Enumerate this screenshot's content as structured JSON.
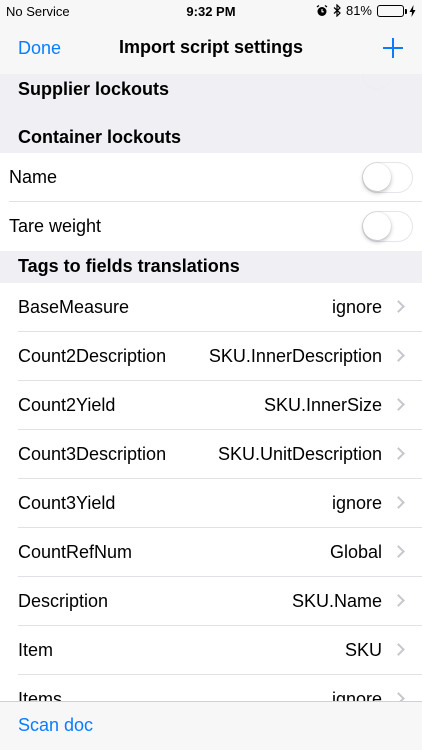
{
  "status_bar": {
    "carrier": "No Service",
    "time": "9:32 PM",
    "battery": "81%",
    "battery_level": 0.81,
    "icons": [
      "alarm-icon",
      "bluetooth-icon",
      "battery-icon",
      "charging-icon"
    ]
  },
  "nav": {
    "done_label": "Done",
    "title": "Import script settings",
    "add_icon": "plus-icon"
  },
  "sections": {
    "supplier_lockouts": "Supplier lockouts",
    "container_lockouts": "Container lockouts",
    "tags_to_fields": "Tags to fields translations"
  },
  "container_lockouts": [
    {
      "label": "Name",
      "on": false
    },
    {
      "label": "Tare weight",
      "on": false
    }
  ],
  "translations": [
    {
      "tag": "BaseMeasure",
      "field": "ignore"
    },
    {
      "tag": "Count2Description",
      "field": "SKU.InnerDescription"
    },
    {
      "tag": "Count2Yield",
      "field": "SKU.InnerSize"
    },
    {
      "tag": "Count3Description",
      "field": "SKU.UnitDescription"
    },
    {
      "tag": "Count3Yield",
      "field": "ignore"
    },
    {
      "tag": "CountRefNum",
      "field": "Global"
    },
    {
      "tag": "Description",
      "field": "SKU.Name"
    },
    {
      "tag": "Item",
      "field": "SKU"
    },
    {
      "tag": "Items",
      "field": "ignore"
    }
  ],
  "toolbar": {
    "scan_label": "Scan doc"
  },
  "colors": {
    "accent": "#0a7cff",
    "background": "#efeff4",
    "battery_fill": "#4cd964"
  }
}
